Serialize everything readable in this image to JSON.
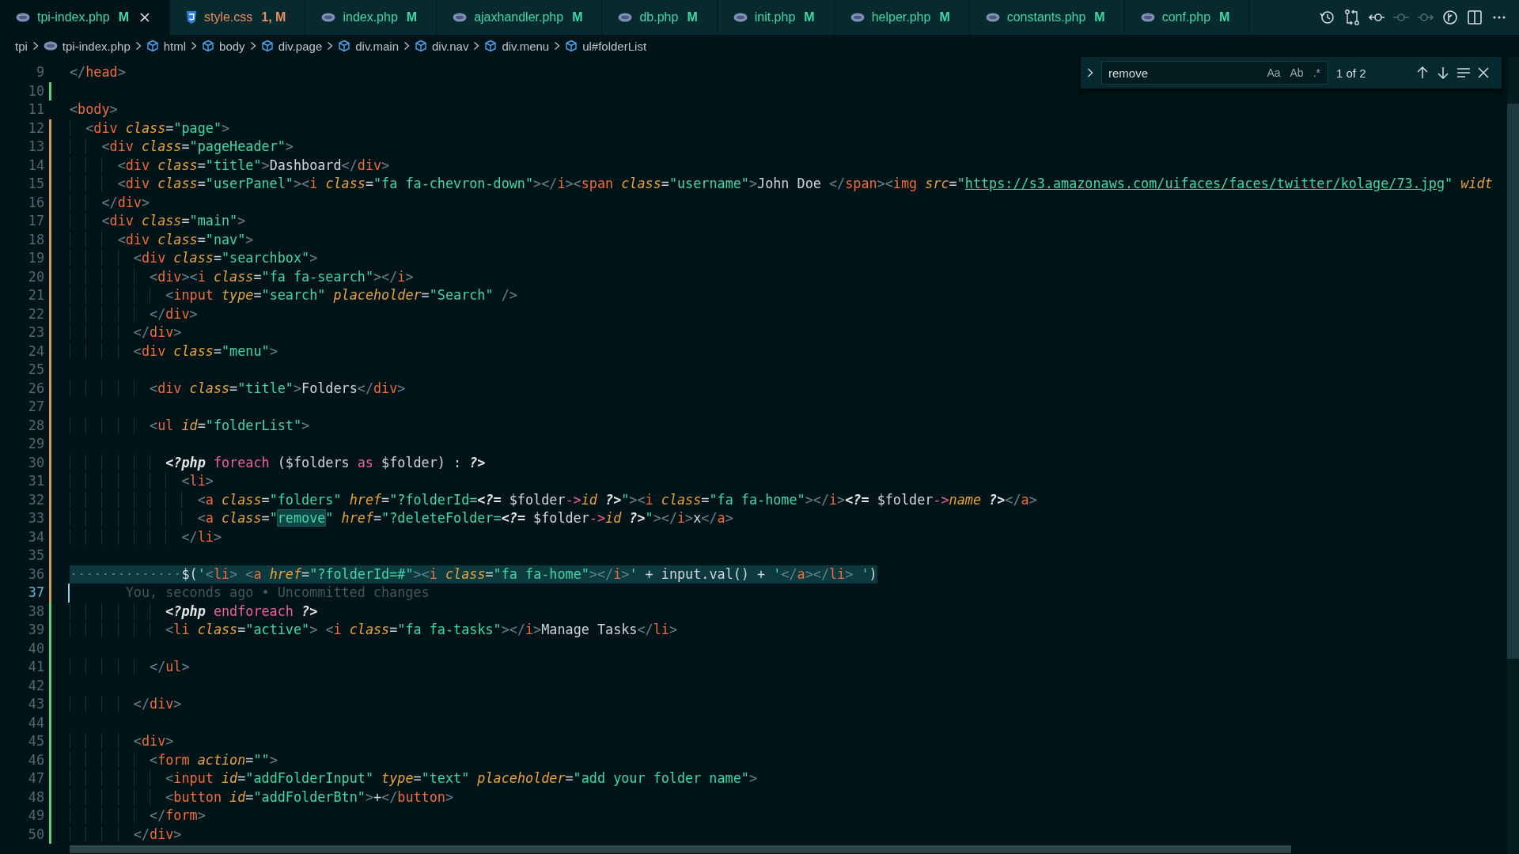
{
  "tabs": [
    {
      "label": "tpi-index.php",
      "badge": "M",
      "kind": "php",
      "color": "#3fd8a6",
      "selected": true
    },
    {
      "label": "style.css",
      "badge": "1, M",
      "kind": "css",
      "color": "#ec8c5a",
      "selected": false
    },
    {
      "label": "index.php",
      "badge": "M",
      "kind": "php",
      "color": "#3fd8a6",
      "selected": false
    },
    {
      "label": "ajaxhandler.php",
      "badge": "M",
      "kind": "php",
      "color": "#3fd8a6",
      "selected": false
    },
    {
      "label": "db.php",
      "badge": "M",
      "kind": "php",
      "color": "#3fd8a6",
      "selected": false
    },
    {
      "label": "init.php",
      "badge": "M",
      "kind": "php",
      "color": "#3fd8a6",
      "selected": false
    },
    {
      "label": "helper.php",
      "badge": "M",
      "kind": "php",
      "color": "#3fd8a6",
      "selected": false
    },
    {
      "label": "constants.php",
      "badge": "M",
      "kind": "php",
      "color": "#3fd8a6",
      "selected": false
    },
    {
      "label": "conf.php",
      "badge": "M",
      "kind": "php",
      "color": "#3fd8a6",
      "selected": false
    }
  ],
  "toolbar": [
    {
      "kind": "history",
      "disabled": false
    },
    {
      "kind": "compare",
      "disabled": false
    },
    {
      "kind": "commit-prev",
      "disabled": false
    },
    {
      "kind": "commit",
      "disabled": true
    },
    {
      "kind": "commit-next",
      "disabled": true
    },
    {
      "kind": "timeline",
      "disabled": false
    },
    {
      "kind": "split",
      "disabled": false
    },
    {
      "kind": "more",
      "disabled": false
    }
  ],
  "breadcrumbs": [
    {
      "label": "tpi",
      "kind": "folder"
    },
    {
      "label": "tpi-index.php",
      "kind": "file"
    },
    {
      "label": "html",
      "kind": "element"
    },
    {
      "label": "body",
      "kind": "element"
    },
    {
      "label": "div.page",
      "kind": "element"
    },
    {
      "label": "div.main",
      "kind": "element"
    },
    {
      "label": "div.nav",
      "kind": "element"
    },
    {
      "label": "div.menu",
      "kind": "element"
    },
    {
      "label": "ul#folderList",
      "kind": "element"
    }
  ],
  "find": {
    "value": "remove",
    "expanded": false,
    "options": [
      {
        "label": "Aa",
        "on": false
      },
      {
        "label": "Ab",
        "on": false
      },
      {
        "label": ".*",
        "on": false
      }
    ],
    "count": "1 of 2"
  },
  "lines": [
    {
      "n": "9",
      "added": false,
      "modified": false,
      "highlighted": false,
      "current": false,
      "text": "</head>"
    },
    {
      "n": "10",
      "added": true,
      "modified": false,
      "highlighted": false,
      "current": false
    },
    {
      "n": "11",
      "added": false,
      "modified": false,
      "highlighted": false,
      "current": false,
      "text": "<body>"
    },
    {
      "n": "12",
      "added": false,
      "modified": true,
      "highlighted": false,
      "current": false,
      "text": "  <div class=\"page\">"
    },
    {
      "n": "13",
      "added": false,
      "modified": true,
      "highlighted": false,
      "current": false,
      "text": "    <div class=\"pageHeader\">"
    },
    {
      "n": "14",
      "added": false,
      "modified": true,
      "highlighted": false,
      "current": false,
      "text": "      <div class=\"title\">Dashboard</div>"
    },
    {
      "n": "15",
      "added": false,
      "modified": true,
      "highlighted": false,
      "current": false,
      "text": "      <div class=\"userPanel\"><i class=\"fa fa-chevron-down\"></i><span class=\"username\">John Doe </span><img src=\"https://s3.amazonaws.com/uifaces/faces/twitter/kolage/73.jpg\" widt"
    },
    {
      "n": "16",
      "added": false,
      "modified": true,
      "highlighted": false,
      "current": false,
      "text": "    </div>"
    },
    {
      "n": "17",
      "added": false,
      "modified": true,
      "highlighted": false,
      "current": false,
      "text": "    <div class=\"main\">"
    },
    {
      "n": "18",
      "added": false,
      "modified": true,
      "highlighted": false,
      "current": false,
      "text": "      <div class=\"nav\">"
    },
    {
      "n": "19",
      "added": false,
      "modified": true,
      "highlighted": false,
      "current": false,
      "text": "        <div class=\"searchbox\">"
    },
    {
      "n": "20",
      "added": false,
      "modified": true,
      "highlighted": false,
      "current": false,
      "text": "          <div><i class=\"fa fa-search\"></i>"
    },
    {
      "n": "21",
      "added": false,
      "modified": true,
      "highlighted": false,
      "current": false,
      "text": "            <input type=\"search\" placeholder=\"Search\" />"
    },
    {
      "n": "22",
      "added": false,
      "modified": true,
      "highlighted": false,
      "current": false,
      "text": "          </div>"
    },
    {
      "n": "23",
      "added": false,
      "modified": true,
      "highlighted": false,
      "current": false,
      "text": "        </div>"
    },
    {
      "n": "24",
      "added": false,
      "modified": true,
      "highlighted": false,
      "current": false,
      "text": "        <div class=\"menu\">"
    },
    {
      "n": "25",
      "added": false,
      "modified": true,
      "highlighted": false,
      "current": false
    },
    {
      "n": "26",
      "added": false,
      "modified": true,
      "highlighted": false,
      "current": false,
      "text": "          <div class=\"title\">Folders</div>"
    },
    {
      "n": "27",
      "added": false,
      "modified": true,
      "highlighted": false,
      "current": false
    },
    {
      "n": "28",
      "added": false,
      "modified": true,
      "highlighted": false,
      "current": false,
      "text": "          <ul id=\"folderList\">"
    },
    {
      "n": "29",
      "added": false,
      "modified": true,
      "highlighted": false,
      "current": false
    },
    {
      "n": "30",
      "added": false,
      "modified": true,
      "highlighted": false,
      "current": false,
      "text": "            <?php foreach ($folders as $folder) : ?>"
    },
    {
      "n": "31",
      "added": false,
      "modified": true,
      "highlighted": false,
      "current": false,
      "text": "              <li>"
    },
    {
      "n": "32",
      "added": false,
      "modified": true,
      "highlighted": false,
      "current": false,
      "text": "                <a class=\"folders\" href=\"?folderId=<?= $folder->id ?>\"><i class=\"fa fa-home\"></i><?= $folder->name ?></a>"
    },
    {
      "n": "33",
      "added": false,
      "modified": true,
      "highlighted": false,
      "current": false,
      "text": "                <a class=\"remove\" href=\"?deleteFolder=<?= $folder->id ?>\"></i>x</a>"
    },
    {
      "n": "34",
      "added": false,
      "modified": true,
      "highlighted": false,
      "current": false,
      "text": "              </li>"
    },
    {
      "n": "35",
      "added": false,
      "modified": true,
      "highlighted": false,
      "current": false
    },
    {
      "n": "36",
      "added": false,
      "modified": true,
      "highlighted": true,
      "current": false,
      "text": "              $('<li> <a href=\"?folderId=#\"><i class=\"fa fa-home\"></i>' + input.val() + '</a></li> ')"
    },
    {
      "n": "37",
      "added": false,
      "modified": true,
      "highlighted": false,
      "current": true,
      "blame": "You, seconds ago • Uncommitted changes"
    },
    {
      "n": "38",
      "added": true,
      "modified": false,
      "highlighted": false,
      "current": false,
      "text": "            <?php endforeach ?>"
    },
    {
      "n": "39",
      "added": true,
      "modified": false,
      "highlighted": false,
      "current": false,
      "text": "            <li class=\"active\"> <i class=\"fa fa-tasks\"></i>Manage Tasks</li>"
    },
    {
      "n": "40",
      "added": true,
      "modified": false,
      "highlighted": false,
      "current": false
    },
    {
      "n": "41",
      "added": true,
      "modified": false,
      "highlighted": false,
      "current": false,
      "text": "          </ul>"
    },
    {
      "n": "42",
      "added": true,
      "modified": false,
      "highlighted": false,
      "current": false
    },
    {
      "n": "43",
      "added": true,
      "modified": false,
      "highlighted": false,
      "current": false,
      "text": "        </div>"
    },
    {
      "n": "44",
      "added": true,
      "modified": false,
      "highlighted": false,
      "current": false
    },
    {
      "n": "45",
      "added": true,
      "modified": false,
      "highlighted": false,
      "current": false,
      "text": "        <div>"
    },
    {
      "n": "46",
      "added": true,
      "modified": false,
      "highlighted": false,
      "current": false,
      "text": "          <form action=\"\">"
    },
    {
      "n": "47",
      "added": true,
      "modified": false,
      "highlighted": false,
      "current": false,
      "text": "            <input id=\"addFolderInput\" type=\"text\" placeholder=\"add your folder name\">"
    },
    {
      "n": "48",
      "added": true,
      "modified": false,
      "highlighted": false,
      "current": false,
      "text": "            <button id=\"addFolderBtn\">+</button>"
    },
    {
      "n": "49",
      "added": true,
      "modified": false,
      "highlighted": false,
      "current": false,
      "text": "          </form>"
    },
    {
      "n": "50",
      "added": true,
      "modified": false,
      "highlighted": false,
      "current": false,
      "text": "        </div>"
    }
  ]
}
